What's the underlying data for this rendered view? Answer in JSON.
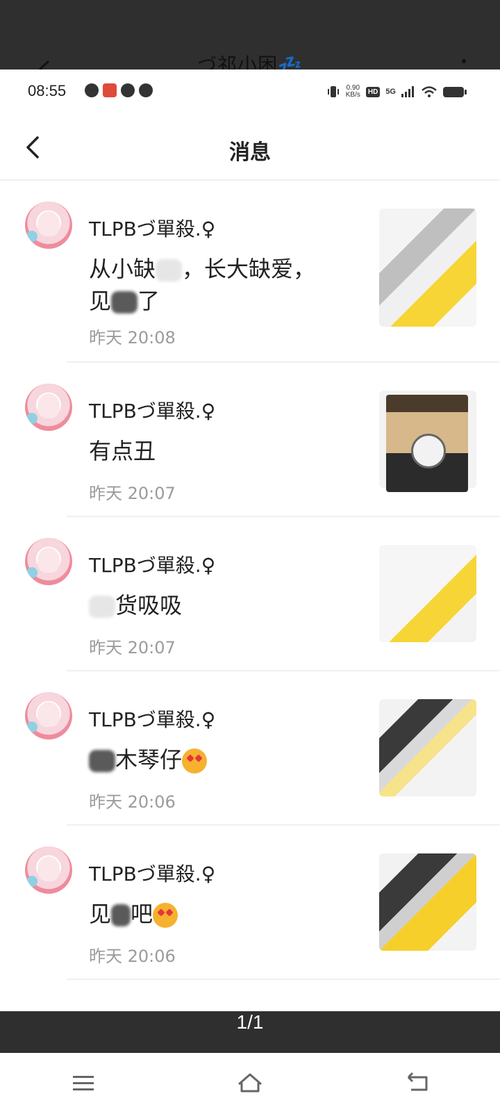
{
  "background": {
    "title": "づ祁小困💤"
  },
  "statusbar": {
    "time": "08:55",
    "net_speed_value": "0.90",
    "net_speed_unit": "KB/s",
    "hd_label": "HD",
    "network": "5G"
  },
  "header": {
    "title": "消息"
  },
  "messages": [
    {
      "sender": "TLPBづ單殺.♀",
      "text_a": "从小缺",
      "text_b": "，长大缺爱，见",
      "text_c": "了",
      "time": "昨天 20:08"
    },
    {
      "sender": "TLPBづ單殺.♀",
      "text": "有点丑",
      "time": "昨天 20:07"
    },
    {
      "sender": "TLPBづ單殺.♀",
      "text": "货吸吸",
      "time": "昨天 20:07"
    },
    {
      "sender": "TLPBづ單殺.♀",
      "text": "木琴仔",
      "time": "昨天 20:06"
    },
    {
      "sender": "TLPBづ單殺.♀",
      "text_a": "见",
      "text_b": "吧",
      "time": "昨天 20:06"
    }
  ],
  "pager": {
    "text": "1/1"
  }
}
